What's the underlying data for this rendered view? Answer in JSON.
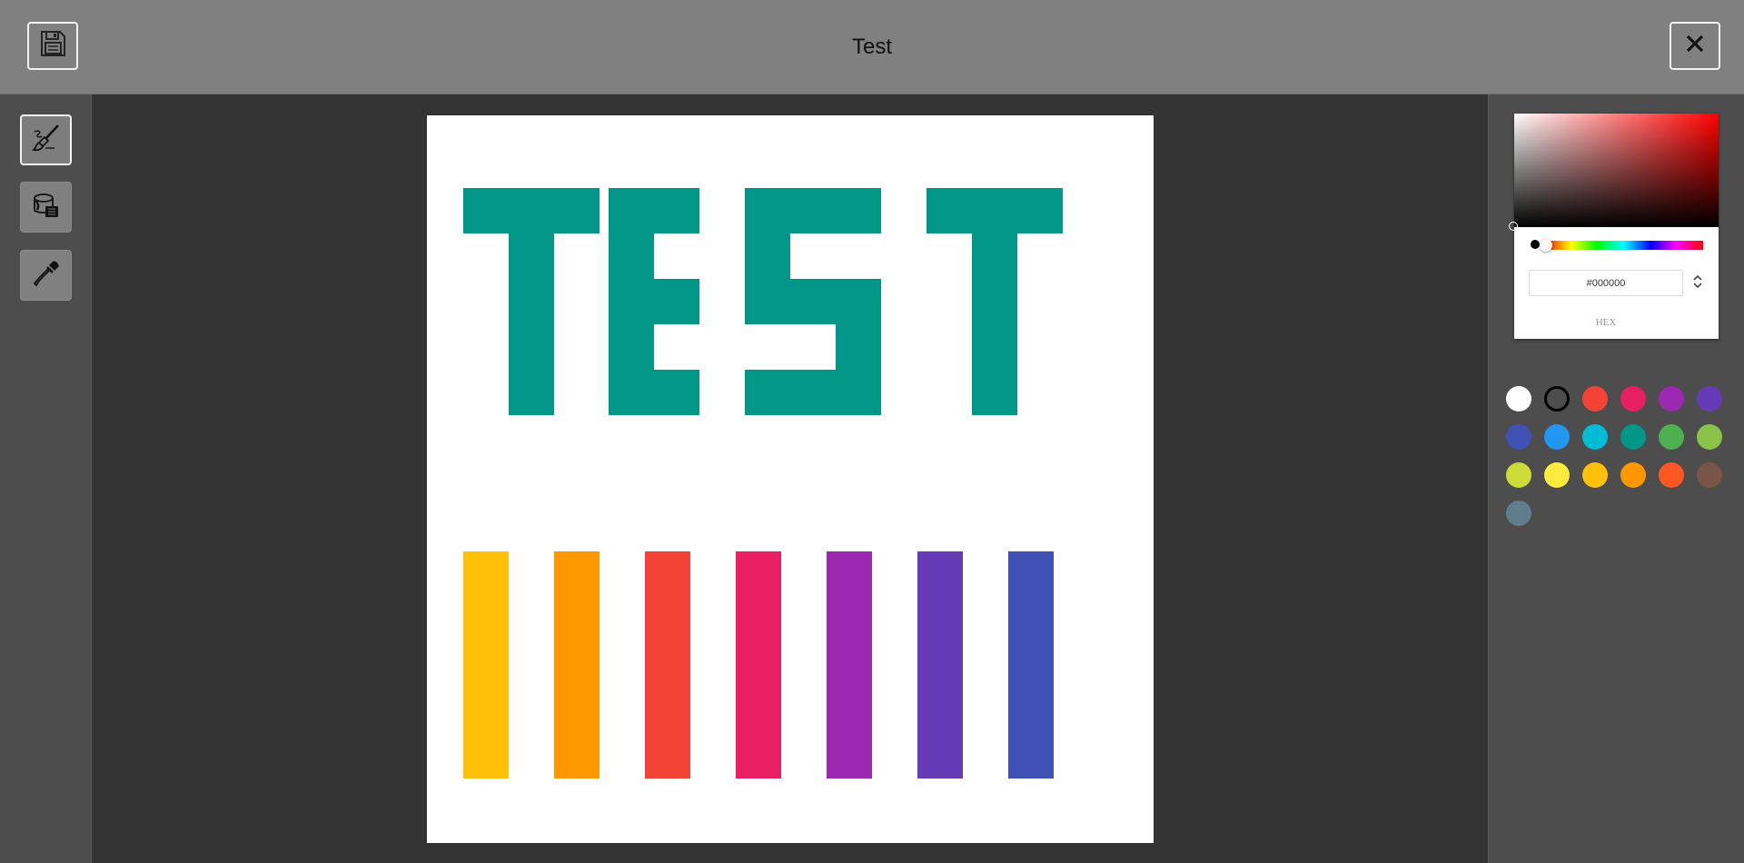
{
  "header": {
    "title": "Test",
    "save_icon": "floppy-disk-icon",
    "close_icon": "close-icon"
  },
  "toolbar": {
    "tools": [
      {
        "name": "brush",
        "icon": "paintbrush-icon",
        "active": true
      },
      {
        "name": "bucket",
        "icon": "paint-bucket-icon",
        "active": false
      },
      {
        "name": "eyedropper",
        "icon": "eyedropper-icon",
        "active": false
      }
    ]
  },
  "canvas": {
    "background": "#ffffff",
    "text_color": "#009688",
    "bar_colors": [
      "#FFC107",
      "#FF9800",
      "#F44336",
      "#E91E63",
      "#9C27B0",
      "#673AB7",
      "#3F51B5"
    ]
  },
  "color_picker": {
    "hex_value": "#000000",
    "mode_label": "HEX",
    "current_color": "#000000",
    "hue": 0
  },
  "swatches": [
    {
      "color": "#FFFFFF",
      "selected": false
    },
    {
      "color": "#000000",
      "selected": true
    },
    {
      "color": "#F44336",
      "selected": false
    },
    {
      "color": "#E91E63",
      "selected": false
    },
    {
      "color": "#9C27B0",
      "selected": false
    },
    {
      "color": "#673AB7",
      "selected": false
    },
    {
      "color": "#3F51B5",
      "selected": false
    },
    {
      "color": "#2196F3",
      "selected": false
    },
    {
      "color": "#00BCD4",
      "selected": false
    },
    {
      "color": "#009688",
      "selected": false
    },
    {
      "color": "#4CAF50",
      "selected": false
    },
    {
      "color": "#8BC34A",
      "selected": false
    },
    {
      "color": "#CDDC39",
      "selected": false
    },
    {
      "color": "#FFEB3B",
      "selected": false
    },
    {
      "color": "#FFC107",
      "selected": false
    },
    {
      "color": "#FF9800",
      "selected": false
    },
    {
      "color": "#FF5722",
      "selected": false
    },
    {
      "color": "#795548",
      "selected": false
    },
    {
      "color": "#607D8B",
      "selected": false
    }
  ]
}
